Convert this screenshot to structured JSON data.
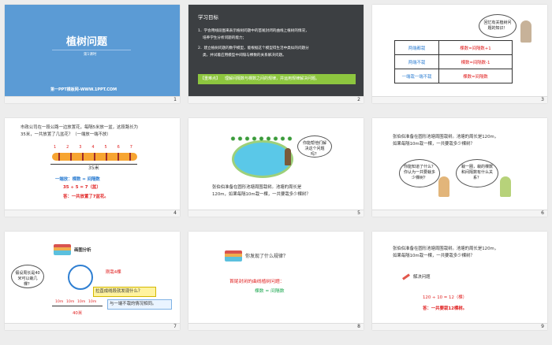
{
  "slides": [
    {
      "num": "1",
      "title": "植树问题",
      "subtitle": "第1课时",
      "footer": "第一PPT模板网-WWW.1PPT.COM"
    },
    {
      "num": "2",
      "heading": "学习目标",
      "goal1": "1．学会用线段图来表示植树问题中的首尾封闭的曲线上植树的情况，",
      "goal1b": "培养学生分析问题的能力；",
      "goal2": "2．建立植树问题的数学模型，能根据这个模型得生活中类似的问题分",
      "goal2b": "类，并试着应用模型中间隔与棵数的关系解决问题。",
      "key_tag": "【重难点】",
      "key_text": "理解间隔数与棵数之间的规律，并运用规律解决问题。"
    },
    {
      "num": "3",
      "bubble": "回忆有关植树问题的知识！",
      "rows": [
        [
          "两端都栽",
          "棵数=间隔数+1"
        ],
        [
          "两端不栽",
          "棵数=间隔数-1"
        ],
        [
          "一端栽一端不栽",
          "棵数=间隔数"
        ]
      ]
    },
    {
      "num": "4",
      "problem1": "市政公司在一段公路一边放置花，每隔5米放一盆，这段路长为",
      "problem2": "35米，一共放置了几盆花？（一端放一端不放）",
      "numbers": [
        "1",
        "2",
        "3",
        "4",
        "5",
        "6",
        "7"
      ],
      "length": "35米",
      "formula_title": "一端放：棵数 = 间隔数",
      "formula": "35 ÷ 5 = 7（盆）",
      "answer": "答：一共放置了7盆花。"
    },
    {
      "num": "5",
      "bubble": "你能帮他们解决这个问题吗？",
      "problem1": "张伯伯准备在圆形池塘周围栽树。池塘的周长是",
      "problem2": "120m，如果每隔10m栽一棵，一共要栽多少棵树？"
    },
    {
      "num": "6",
      "problem1": "张伯伯准备在圆形池塘周围栽树。池塘的周长是120m，",
      "problem2": "如果每隔10m栽一棵，一共要栽多少棵树？",
      "bubble1": "你能知道了什么？你认为一共要栽多少棵树？",
      "bubble2": "栽一圈，栽的棵数和间隔数有什么关系？"
    },
    {
      "num": "7",
      "heading": "画图分析",
      "bubble": "假设周长是40米可以栽几棵？",
      "label_trees": "刚栽4棵",
      "label_line": "拉直成线段就发现什么？",
      "segment": "10m",
      "total": "40米",
      "compare": "与一端不栽的情况相同。"
    },
    {
      "num": "8",
      "question": "你发现了什么规律？",
      "rule_title": "首尾封闭的曲线植树问题：",
      "rule": "棵数 = 间隔数"
    },
    {
      "num": "9",
      "problem1": "张伯伯准备在圆形池塘周围栽树。池塘的周长是120m，",
      "problem2": "如果每隔10m栽一棵，一共要栽多少棵树？",
      "solve": "解决问题",
      "formula": "120 ÷ 10 = 12（棵）",
      "answer": "答：一共要栽12棵树。"
    }
  ]
}
